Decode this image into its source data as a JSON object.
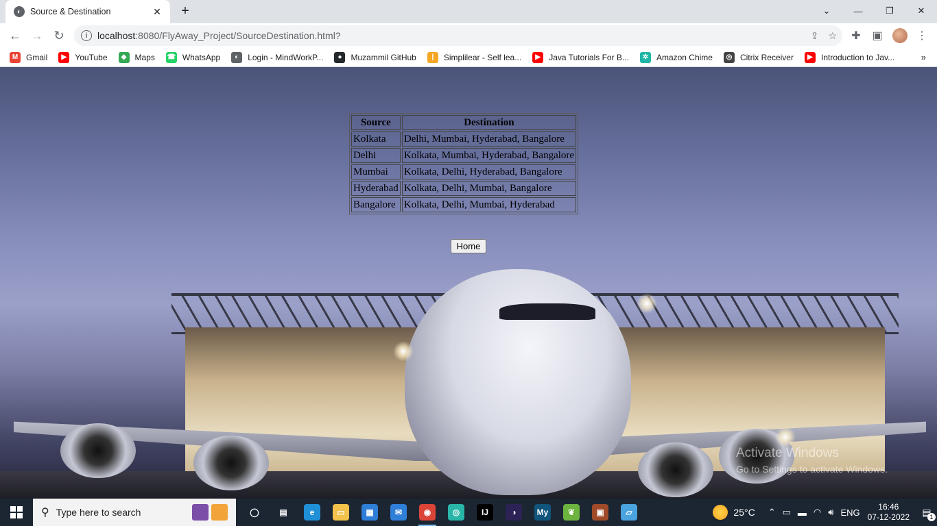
{
  "browser": {
    "tab_title": "Source & Destination",
    "tab_close": "✕",
    "new_tab": "+",
    "url_host": "localhost",
    "url_path": ":8080/FlyAway_Project/SourceDestination.html?",
    "bookmarks": [
      {
        "label": "Gmail",
        "icon": "gmail-icon",
        "color": "#ea4335",
        "glyph": "M"
      },
      {
        "label": "YouTube",
        "icon": "youtube-icon",
        "color": "#ff0000",
        "glyph": "▶"
      },
      {
        "label": "Maps",
        "icon": "maps-icon",
        "color": "#34a853",
        "glyph": "◆"
      },
      {
        "label": "WhatsApp",
        "icon": "whatsapp-icon",
        "color": "#25d366",
        "glyph": "☎"
      },
      {
        "label": "Login - MindWorkP...",
        "icon": "globe-icon",
        "color": "#5f6368",
        "glyph": "◐"
      },
      {
        "label": "Muzammil GitHub",
        "icon": "github-icon",
        "color": "#24292e",
        "glyph": "●"
      },
      {
        "label": "Simplilear - Self lea...",
        "icon": "simplilearn-icon",
        "color": "#f5a623",
        "glyph": "|"
      },
      {
        "label": "Java Tutorials For B...",
        "icon": "youtube-icon",
        "color": "#ff0000",
        "glyph": "▶"
      },
      {
        "label": "Amazon Chime",
        "icon": "chime-icon",
        "color": "#1fb6a6",
        "glyph": "✲"
      },
      {
        "label": "Citrix Receiver",
        "icon": "citrix-icon",
        "color": "#444",
        "glyph": "◎"
      },
      {
        "label": "Introduction to Jav...",
        "icon": "youtube-icon",
        "color": "#ff0000",
        "glyph": "▶"
      }
    ],
    "bookmarks_more": "»"
  },
  "table": {
    "headers": [
      "Source",
      "Destination"
    ],
    "rows": [
      [
        "Kolkata",
        "Delhi, Mumbai, Hyderabad, Bangalore"
      ],
      [
        "Delhi",
        "Kolkata, Mumbai, Hyderabad, Bangalore"
      ],
      [
        "Mumbai",
        "Kolkata, Delhi, Hyderabad, Bangalore"
      ],
      [
        "Hyderabad",
        "Kolkata, Delhi, Mumbai, Bangalore"
      ],
      [
        "Bangalore",
        "Kolkata, Delhi, Mumbai, Hyderabad"
      ]
    ]
  },
  "home_button": "Home",
  "watermark": {
    "line1": "Activate Windows",
    "line2": "Go to Settings to activate Windows."
  },
  "taskbar": {
    "search_placeholder": "Type here to search",
    "apps": [
      {
        "name": "task-view-icon",
        "glyph": "◯",
        "color": "transparent"
      },
      {
        "name": "widgets-icon",
        "glyph": "▤",
        "color": "transparent"
      },
      {
        "name": "edge-icon",
        "glyph": "e",
        "color": "#1f8fd8"
      },
      {
        "name": "file-explorer-icon",
        "glyph": "▭",
        "color": "#f2c24b"
      },
      {
        "name": "store-icon",
        "glyph": "▦",
        "color": "#2f7ed8"
      },
      {
        "name": "mail-icon",
        "glyph": "✉",
        "color": "#2f7ed8"
      },
      {
        "name": "chrome-icon",
        "glyph": "◉",
        "color": "#db4437"
      },
      {
        "name": "app-icon",
        "glyph": "◎",
        "color": "#29b6a8"
      },
      {
        "name": "intellij-icon",
        "glyph": "IJ",
        "color": "#000"
      },
      {
        "name": "eclipse-icon",
        "glyph": "◑",
        "color": "#2c2255"
      },
      {
        "name": "mysql-icon",
        "glyph": "My",
        "color": "#11557c"
      },
      {
        "name": "spring-icon",
        "glyph": "❦",
        "color": "#6db33f"
      },
      {
        "name": "sts-icon",
        "glyph": "▣",
        "color": "#a04a2a"
      },
      {
        "name": "notepad-icon",
        "glyph": "▱",
        "color": "#4aa3df"
      }
    ],
    "weather": "25°C",
    "lang": "ENG",
    "time": "16:46",
    "date": "07-12-2022",
    "notifications": "1"
  }
}
